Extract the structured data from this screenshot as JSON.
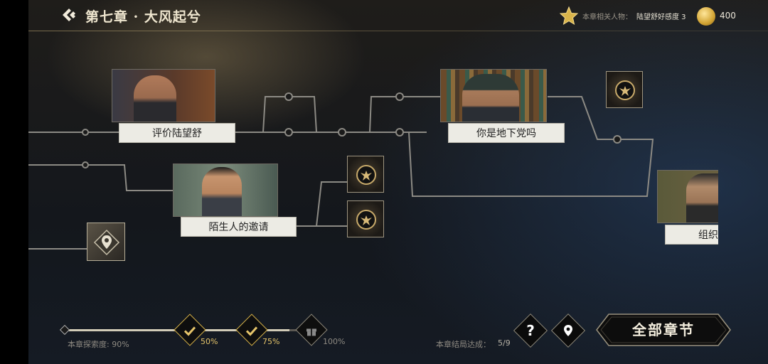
{
  "header": {
    "chapter_title": "第七章 · 大风起兮",
    "related_label": "本章相关人物：",
    "related_value": "陆望舒好感度 3",
    "coins": "400"
  },
  "nodes": [
    {
      "label": "评价陆望舒"
    },
    {
      "label": "陌生人的邀请"
    },
    {
      "label": "你是地下党吗"
    },
    {
      "label": "组织"
    }
  ],
  "footer": {
    "explore_label": "本章探索度: 90%",
    "explore_progress": 0.9,
    "milestones": [
      "50%",
      "75%",
      "100%"
    ],
    "ending_label": "本章结局达成：",
    "ending_value": "5/9",
    "all_chapters": "全部章节"
  },
  "colors": {
    "accent_gold": "#d9b44a",
    "label_bg": "#ecebe4",
    "line": "#8c8a84"
  },
  "icons": [
    "back-chevron-icon",
    "star-icon",
    "coin-icon",
    "emblem-icon",
    "location-pin-icon",
    "check-icon",
    "gift-icon",
    "question-icon"
  ]
}
